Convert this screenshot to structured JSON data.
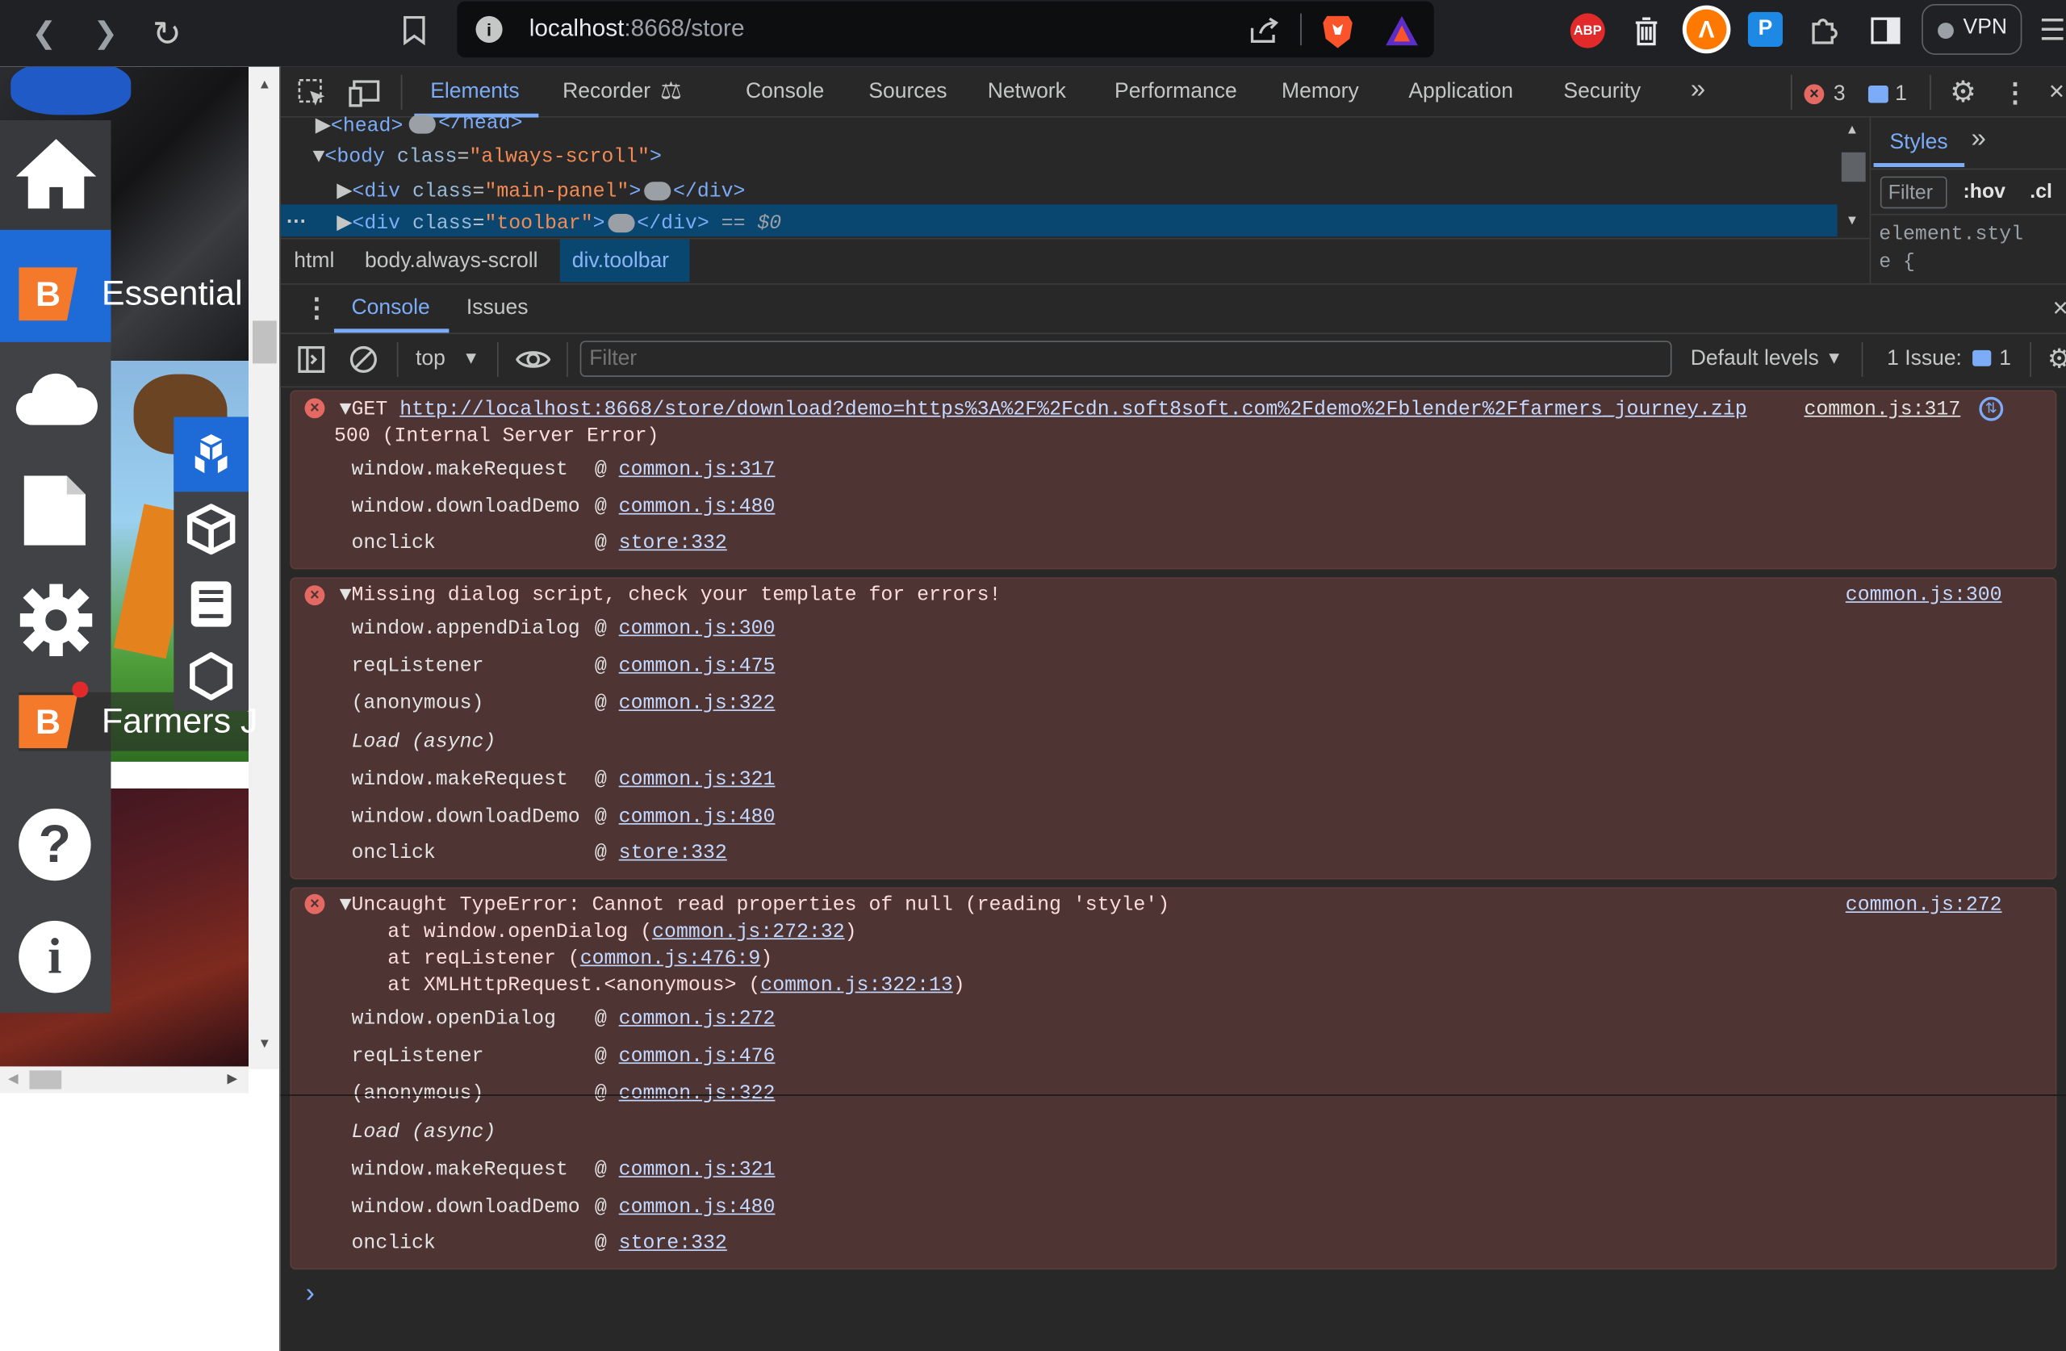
{
  "browser": {
    "url_host": "localhost",
    "url_rest": ":8668/store",
    "icons": [
      "back-icon",
      "forward-icon",
      "reload-icon",
      "bookmark-icon",
      "site-info-icon",
      "share-icon",
      "brave-shield-icon",
      "brave-rewards-icon",
      "adblock-plus-icon",
      "wallet-icon",
      "avast-icon",
      "password-manager-icon",
      "puzzle-icon",
      "sidebar-icon",
      "menu-icon"
    ],
    "abp_label": "ABP",
    "vpn_label": "VPN"
  },
  "leftpage": {
    "items": [
      {
        "badge": "B",
        "label": "Essential"
      },
      {
        "badge": "B",
        "label": "Farmers J"
      }
    ],
    "sidebar_icons": [
      "home-icon",
      "cloud-icon",
      "file-icon",
      "gear-icon",
      "help-icon",
      "info-icon"
    ],
    "tool_icons": [
      "cubes-icon",
      "box-icon",
      "book-icon",
      "hexagon-icon"
    ]
  },
  "devtools": {
    "tabs": [
      "Elements",
      "Recorder",
      "Console",
      "Sources",
      "Network",
      "Performance",
      "Memory",
      "Application",
      "Security"
    ],
    "active_tab": "Elements",
    "error_count": "3",
    "message_count": "1",
    "dom": [
      {
        "open": "<head>",
        "close": "</head>"
      },
      {
        "tag": "body",
        "attr": "class",
        "val": "\"always-scroll\""
      },
      {
        "tag": "div",
        "attr": "class",
        "val": "\"main-panel\"",
        "close": "</div>"
      },
      {
        "tag": "div",
        "attr": "class",
        "val": "\"toolbar\"",
        "close": "</div>",
        "suffix": "== $0"
      }
    ],
    "breadcrumbs": [
      "html",
      "body.always-scroll",
      "div.toolbar"
    ],
    "styles_tab": "Styles",
    "styles_filter": "Filter",
    "hov": ":hov",
    "cls": ".cl",
    "element_style_1": "element.styl",
    "element_style_2": "e {",
    "drawer_tabs": [
      "Console",
      "Issues"
    ],
    "context": "top",
    "filter_placeholder": "Filter",
    "levels": "Default levels",
    "issues_label": "1 Issue:",
    "issues_count": "1"
  },
  "console": {
    "err1": {
      "method": "GET",
      "url": "http://localhost:8668/store/download?demo=https%3A%2F%2Fcdn.soft8soft.com%2Fdemo%2Fblender%2Ffarmers_journey.zip",
      "status": "500 (Internal Server Error)",
      "source": "common.js:317",
      "stack": [
        {
          "fn": "window.makeRequest",
          "src": "common.js:317"
        },
        {
          "fn": "window.downloadDemo",
          "src": "common.js:480"
        },
        {
          "fn": "onclick",
          "src": "store:332"
        }
      ]
    },
    "err2": {
      "message": "Missing dialog script, check your template for errors!",
      "source": "common.js:300",
      "stack": [
        {
          "fn": "window.appendDialog",
          "src": "common.js:300"
        },
        {
          "fn": "reqListener",
          "src": "common.js:475"
        },
        {
          "fn": "(anonymous)",
          "src": "common.js:322"
        }
      ],
      "async": "Load (async)",
      "stack2": [
        {
          "fn": "window.makeRequest",
          "src": "common.js:321"
        },
        {
          "fn": "window.downloadDemo",
          "src": "common.js:480"
        },
        {
          "fn": "onclick",
          "src": "store:332"
        }
      ]
    },
    "err3": {
      "message": "Uncaught TypeError: Cannot read properties of null (reading 'style')",
      "source": "common.js:272",
      "trace": [
        {
          "pre": "    at window.openDialog (",
          "link": "common.js:272:32",
          "post": ")"
        },
        {
          "pre": "    at reqListener (",
          "link": "common.js:476:9",
          "post": ")"
        },
        {
          "pre": "    at XMLHttpRequest.<anonymous> (",
          "link": "common.js:322:13",
          "post": ")"
        }
      ],
      "stack": [
        {
          "fn": "window.openDialog",
          "src": "common.js:272"
        },
        {
          "fn": "reqListener",
          "src": "common.js:476"
        },
        {
          "fn": "(anonymous)",
          "src": "common.js:322"
        }
      ],
      "async": "Load (async)",
      "stack2": [
        {
          "fn": "window.makeRequest",
          "src": "common.js:321"
        },
        {
          "fn": "window.downloadDemo",
          "src": "common.js:480"
        },
        {
          "fn": "onclick",
          "src": "store:332"
        }
      ]
    },
    "at_sign": "@",
    "prompt": "›"
  }
}
